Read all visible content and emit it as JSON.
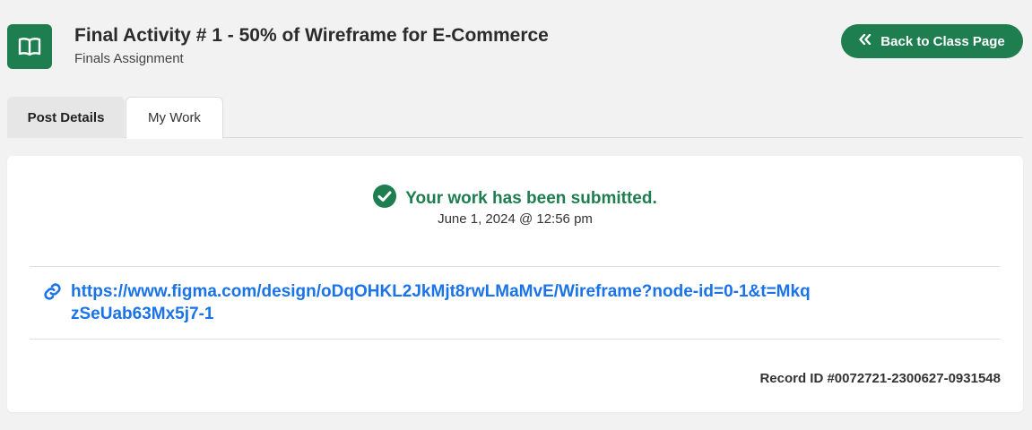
{
  "header": {
    "title": "Final Activity # 1 - 50% of Wireframe for E-Commerce",
    "subtitle": "Finals Assignment",
    "app_icon": "book-open-icon",
    "back_button_label": "Back to Class Page",
    "back_button_icon": "chevrons-left-icon",
    "accent_color": "#1e7e4f"
  },
  "tabs": [
    {
      "label": "Post Details",
      "active": false
    },
    {
      "label": "My Work",
      "active": true
    }
  ],
  "submission": {
    "status_icon": "check-circle-icon",
    "status_text": "Your work has been submitted.",
    "status_color": "#1e7e4f",
    "submitted_at": "June 1, 2024 @ 12:56 pm",
    "link_icon": "link-icon",
    "link_url": "https://www.figma.com/design/oDqOHKL2JkMjt8rwLMaMvE/Wireframe?node-id=0-1&t=MkqzSeUab63Mx5j7-1",
    "link_color": "#1a73e8",
    "record_id": "Record ID #0072721-2300627-0931548"
  }
}
